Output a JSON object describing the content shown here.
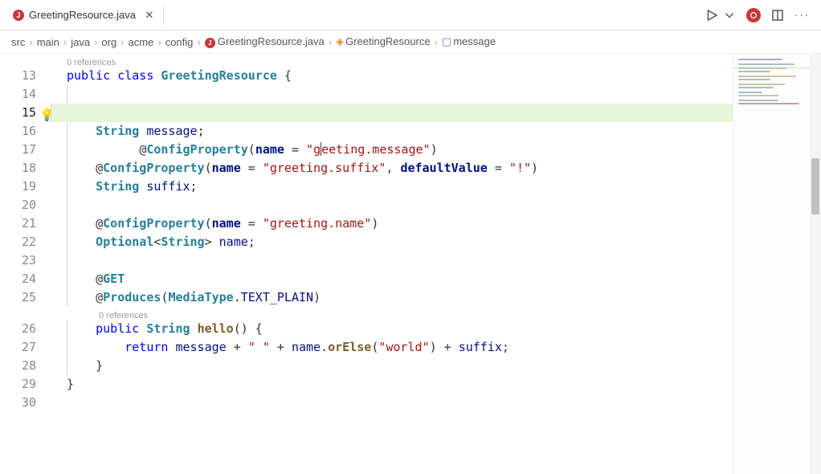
{
  "tab": {
    "icon_letter": "J",
    "filename": "GreetingResource.java"
  },
  "breadcrumbs": {
    "items": [
      "src",
      "main",
      "java",
      "org",
      "acme",
      "config"
    ],
    "file": "GreetingResource.java",
    "class": "GreetingResource",
    "method": "message"
  },
  "line_numbers": [
    "13",
    "14",
    "15",
    "16",
    "17",
    "18",
    "19",
    "20",
    "21",
    "22",
    "23",
    "24",
    "25",
    "26",
    "27",
    "28",
    "29",
    "30"
  ],
  "active_line_index": 2,
  "refs_class": "0 references",
  "refs_method": "0 references",
  "line_class_decl": {
    "public": "public",
    "class": "class",
    "name": "GreetingResource",
    "brace": " {"
  },
  "line15": {
    "at": "@",
    "ann": "ConfigProperty",
    "open": "(",
    "param": "name",
    "eq": " = ",
    "q1": "\"",
    "val_pre": "g",
    "val_post": "eeting.message",
    "q2": "\"",
    "close": ")"
  },
  "line16": {
    "type": "String",
    "sp": " ",
    "name": "message",
    "semi": ";"
  },
  "line18": {
    "at": "@",
    "ann": "ConfigProperty",
    "open": "(",
    "param": "name",
    "eq": " = ",
    "q1": "\"",
    "val": "greeting.suffix",
    "q2": "\"",
    "comma": ", ",
    "param2": "defaultValue",
    "eq2": " = ",
    "q3": "\"",
    "val2": "!",
    "q4": "\"",
    "close": ")"
  },
  "line19": {
    "type": "String",
    "sp": " ",
    "name": "suffix",
    "semi": ";"
  },
  "line21": {
    "at": "@",
    "ann": "ConfigProperty",
    "open": "(",
    "param": "name",
    "eq": " = ",
    "q1": "\"",
    "val": "greeting.name",
    "q2": "\"",
    "close": ")"
  },
  "line22": {
    "type": "Optional",
    "lt": "<",
    "ptype": "String",
    "gt": ">",
    "sp": " ",
    "name": "name",
    "semi": ";"
  },
  "line24": {
    "at": "@",
    "ann": "GET"
  },
  "line25": {
    "at": "@",
    "ann": "Produces",
    "open": "(",
    "t1": "MediaType",
    "dot": ".",
    "t2": "TEXT_PLAIN",
    "close": ")"
  },
  "line26": {
    "public": "public",
    "sp": " ",
    "type": "String",
    "sp2": " ",
    "name": "hello",
    "parens": "()",
    "brace": " {"
  },
  "line27": {
    "indent": "        ",
    "return": "return",
    "sp": " ",
    "v1": "message",
    "op1": " + ",
    "q1": "\"",
    "s1": " ",
    "q2": "\"",
    "op2": " + ",
    "v2": "name",
    "dot": ".",
    "m": "orElse",
    "open": "(",
    "q3": "\"",
    "s2": "world",
    "q4": "\"",
    "close": ")",
    "op3": " + ",
    "v3": "suffix",
    "semi": ";"
  },
  "line28": {
    "brace": "    }"
  },
  "line29": {
    "brace": "}"
  }
}
